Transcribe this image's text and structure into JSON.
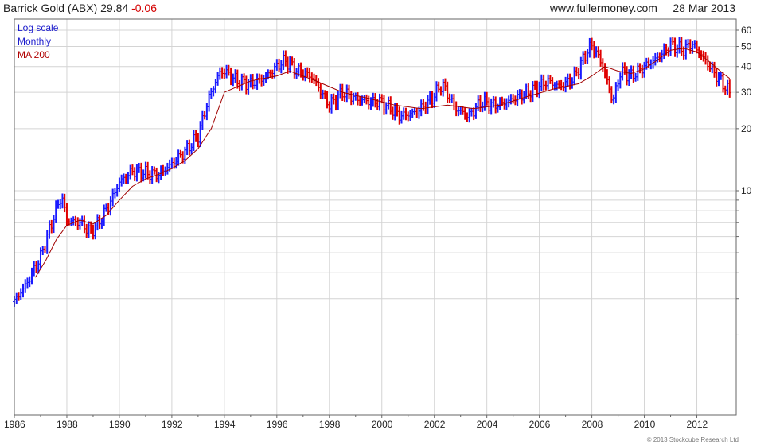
{
  "header": {
    "name": "Barrick Gold (ABX)",
    "price": "29.84",
    "change": "-0.06",
    "site": "www.fullermoney.com",
    "date": "28 Mar 2013"
  },
  "legend": {
    "scale": "Log scale",
    "period": "Monthly",
    "ma": "MA 200"
  },
  "copyright": "© 2013 Stockcube Research Ltd",
  "colors": {
    "up": "#1a1aff",
    "down": "#e00000",
    "ma": "#a00000",
    "grid": "#d4d4d4",
    "border": "#666666"
  },
  "chart_data": {
    "type": "line",
    "scale": "log",
    "ylim": [
      2,
      65
    ],
    "xlim": [
      1986,
      2013.5
    ],
    "y_ticks": [
      10,
      20,
      30,
      40,
      50,
      60
    ],
    "x_ticks": [
      "1986",
      "1988",
      "1990",
      "1992",
      "1994",
      "1996",
      "1998",
      "2000",
      "2002",
      "2004",
      "2006",
      "2008",
      "2010",
      "2012"
    ],
    "grid": true,
    "legend_position": "top-left",
    "series": [
      {
        "name": "Monthly",
        "x": [
          1986.0,
          1986.5,
          1987.0,
          1987.5,
          1987.8,
          1988.0,
          1988.5,
          1988.9,
          1989.2,
          1989.6,
          1990.0,
          1990.5,
          1991.0,
          1991.5,
          1992.0,
          1992.5,
          1993.0,
          1993.4,
          1993.8,
          1994.0,
          1994.5,
          1995.0,
          1995.5,
          1996.0,
          1996.3,
          1996.8,
          1997.3,
          1997.7,
          1998.0,
          1998.5,
          1999.0,
          1999.5,
          2000.0,
          2000.7,
          2001.3,
          2001.8,
          2002.3,
          2002.8,
          2003.3,
          2003.8,
          2004.3,
          2004.8,
          2005.3,
          2005.8,
          2006.3,
          2006.8,
          2007.3,
          2007.8,
          2008.0,
          2008.4,
          2008.8,
          2009.1,
          2009.5,
          2010.0,
          2010.5,
          2011.0,
          2011.5,
          2011.8,
          2012.2,
          2012.6,
          2013.0,
          2013.25
        ],
        "values": [
          2.9,
          3.6,
          4.8,
          7.5,
          9.5,
          7.2,
          7.0,
          6.3,
          7.0,
          8.5,
          11.0,
          12.5,
          12.2,
          12.0,
          13.5,
          15.5,
          18.5,
          28.0,
          37.0,
          38.0,
          34.0,
          33.0,
          35.0,
          40.0,
          43.0,
          38.0,
          36.0,
          30.0,
          26.0,
          30.0,
          28.0,
          27.0,
          27.0,
          23.0,
          24.0,
          27.0,
          33.0,
          25.0,
          23.0,
          27.0,
          26.0,
          27.0,
          29.0,
          31.0,
          34.0,
          32.0,
          35.0,
          47.0,
          51.0,
          41.0,
          27.0,
          38.0,
          36.0,
          40.0,
          44.0,
          51.0,
          48.0,
          52.0,
          45.0,
          38.0,
          33.0,
          29.84
        ]
      },
      {
        "name": "MA 200",
        "x": [
          1986.8,
          1987.2,
          1987.6,
          1988.0,
          1988.5,
          1989.0,
          1989.5,
          1990.0,
          1990.5,
          1991.0,
          1991.5,
          1992.0,
          1992.5,
          1993.0,
          1993.5,
          1994.0,
          1995.0,
          1996.0,
          1996.5,
          1997.5,
          1998.5,
          1999.5,
          2000.5,
          2001.5,
          2002.5,
          2003.5,
          2004.5,
          2005.5,
          2006.5,
          2007.5,
          2008.0,
          2008.5,
          2009.0,
          2009.5,
          2010.0,
          2010.5,
          2011.0,
          2011.5,
          2012.0,
          2012.5,
          2013.0,
          2013.25
        ],
        "values": [
          3.8,
          4.6,
          5.8,
          6.8,
          7.2,
          6.9,
          7.6,
          9.0,
          10.5,
          11.4,
          12.0,
          12.8,
          14.0,
          16.0,
          20.0,
          30.0,
          34.0,
          36.0,
          38.0,
          34.0,
          30.0,
          28.0,
          26.0,
          25.0,
          26.0,
          25.0,
          26.0,
          28.5,
          31.0,
          33.0,
          36.0,
          40.0,
          38.0,
          37.0,
          39.0,
          43.0,
          48.0,
          49.0,
          47.0,
          42.0,
          37.0,
          35.0
        ]
      }
    ]
  }
}
